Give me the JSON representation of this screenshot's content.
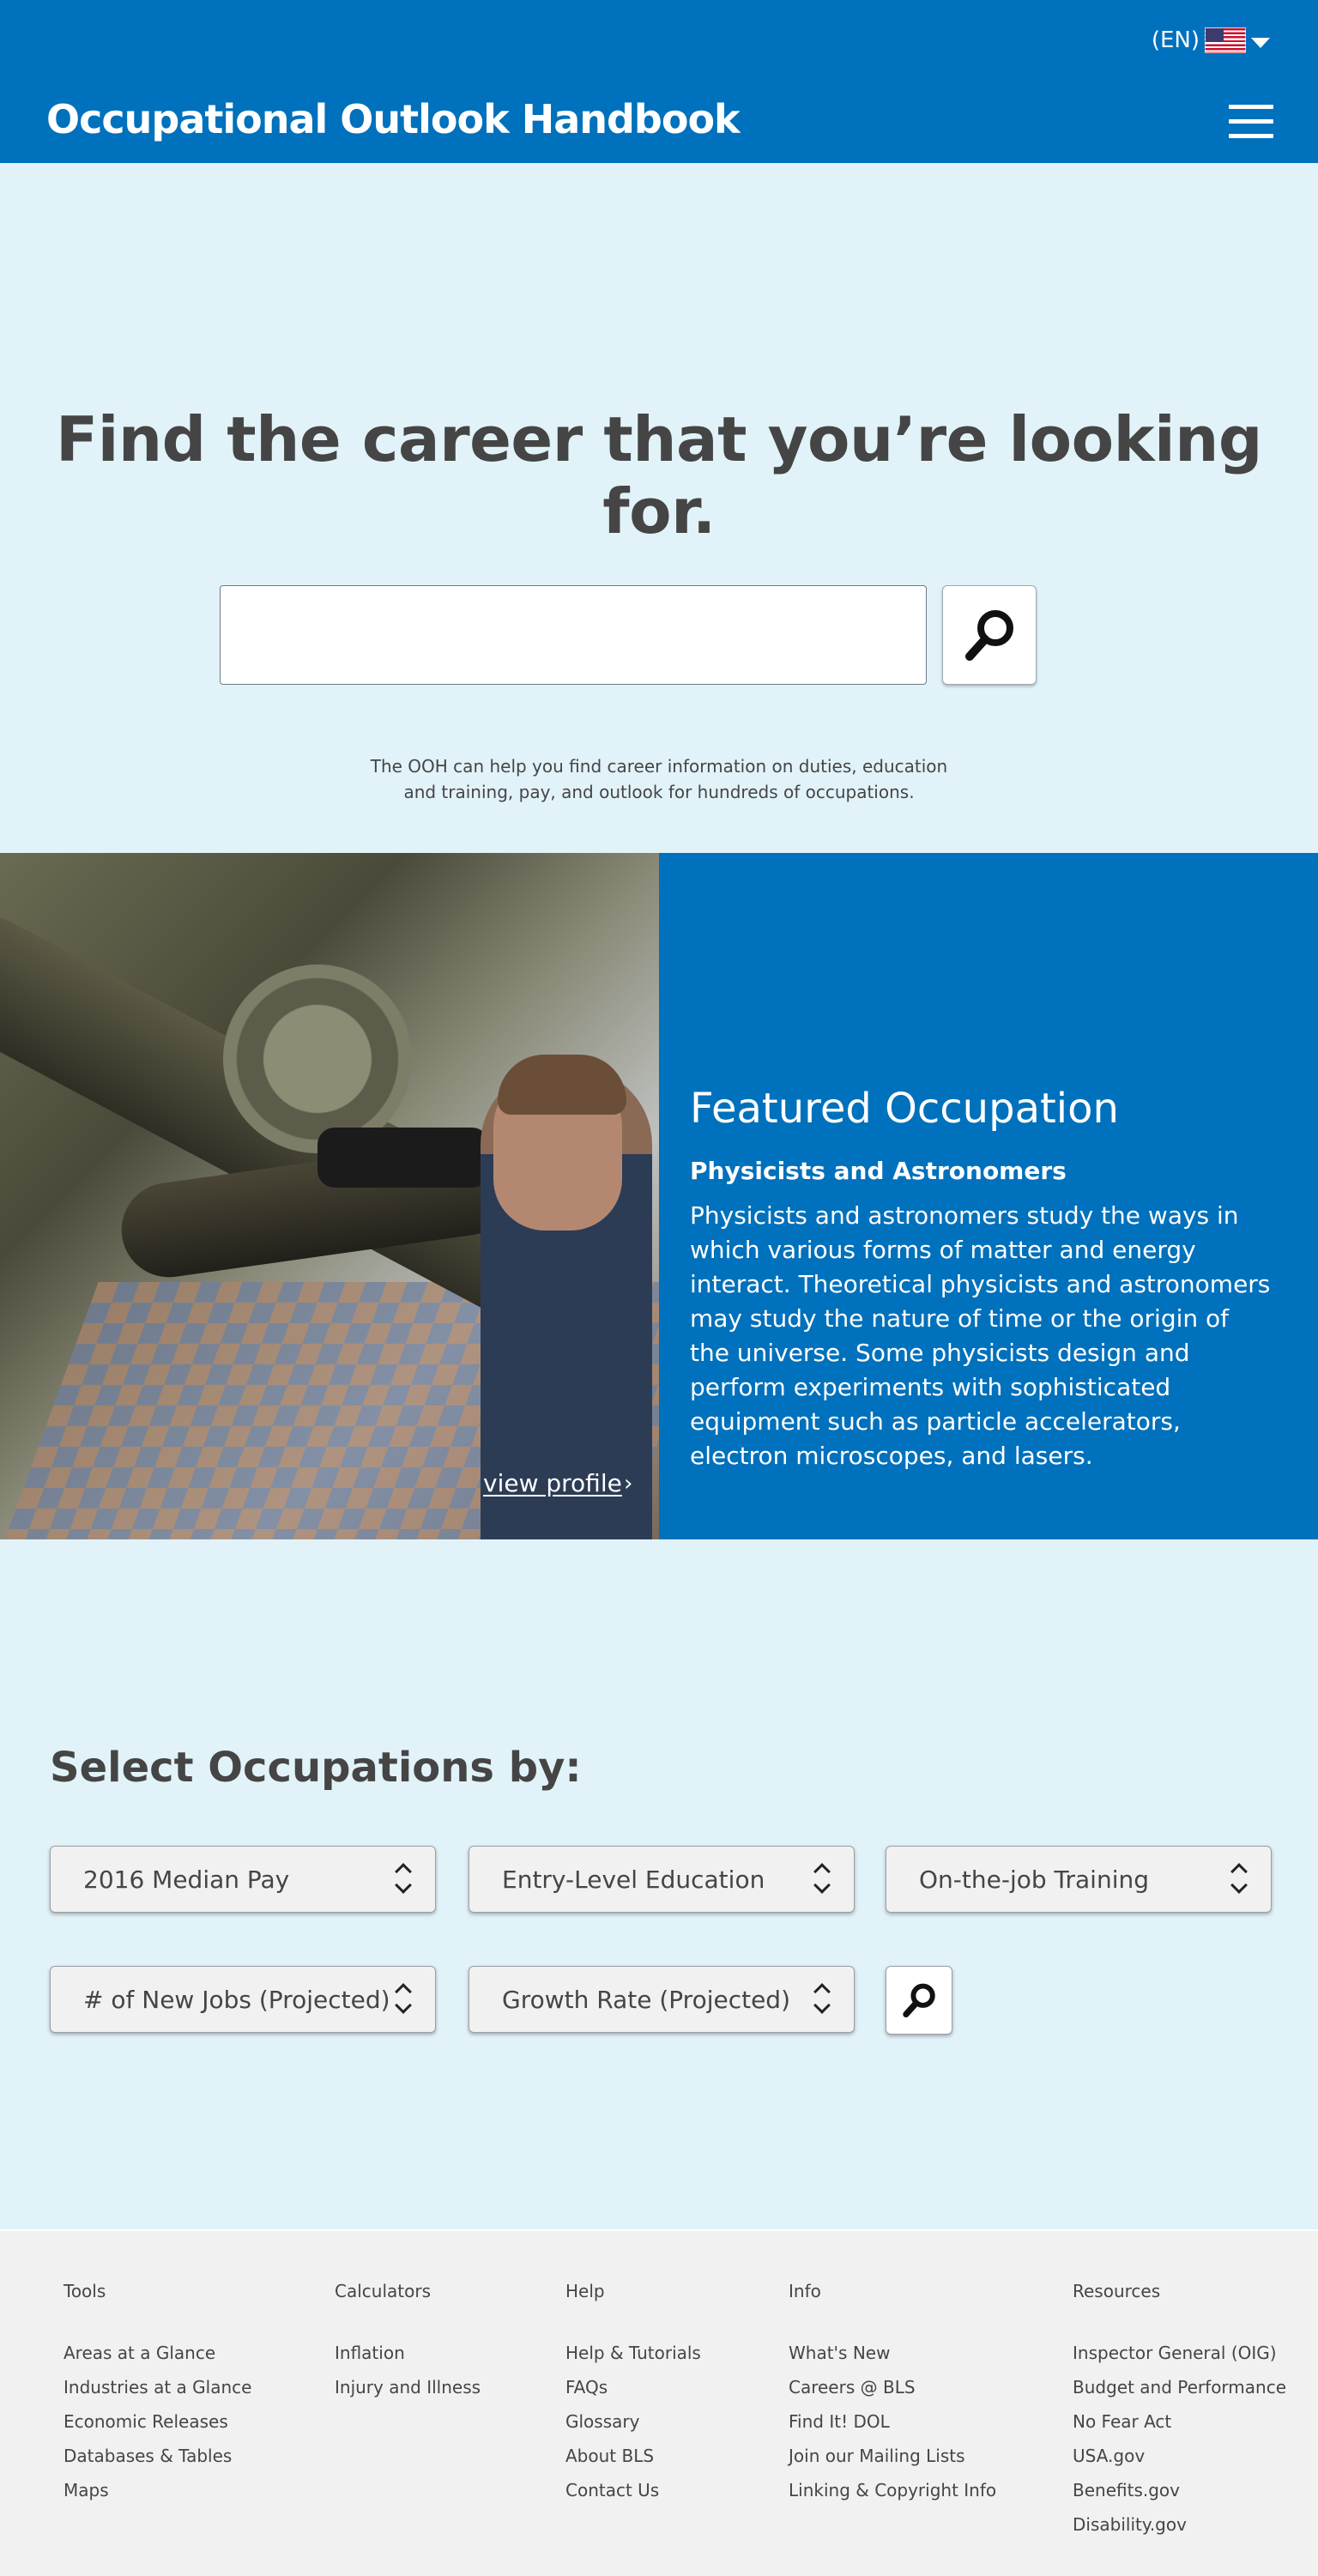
{
  "header": {
    "lang_label": "(EN)",
    "site_title": "Occupational Outlook Handbook"
  },
  "hero": {
    "title": "Find the career that you’re looking for.",
    "search_value": "",
    "description": "The OOH can help you find career information on duties, education and training, pay, and outlook for hundreds of occupations."
  },
  "featured": {
    "heading": "Featured Occupation",
    "occupation": "Physicists and Astronomers",
    "description": "Physicists and astronomers study the ways in which various forms of matter and energy interact. Theoretical physicists and astronomers may study the nature of time or the origin of the universe. Some physicists design and perform experiments with sophisticated equipment such as particle accelerators, electron microscopes, and lasers.",
    "view_profile": "view profile",
    "chevron": "›"
  },
  "select": {
    "title": "Select Occupations by:",
    "dropdowns": [
      {
        "label": "2016 Median Pay"
      },
      {
        "label": "Entry-Level Education"
      },
      {
        "label": "On-the-job Training"
      },
      {
        "label": "# of New Jobs (Projected)"
      },
      {
        "label": "Growth Rate (Projected)"
      }
    ]
  },
  "footer": {
    "columns": [
      {
        "heading": "Tools",
        "links": [
          "Areas at a Glance",
          "Industries at a Glance",
          "Economic Releases",
          "Databases & Tables",
          "Maps"
        ]
      },
      {
        "heading": "Calculators",
        "links": [
          "Inflation",
          "Injury and Illness"
        ]
      },
      {
        "heading": "Help",
        "links": [
          "Help & Tutorials",
          "FAQs",
          "Glossary",
          "About BLS",
          "Contact Us"
        ]
      },
      {
        "heading": "Info",
        "links": [
          "What's New",
          "Careers @ BLS",
          "Find It! DOL",
          "Join our Mailing Lists",
          "Linking & Copyright Info"
        ]
      },
      {
        "heading": "Resources",
        "links": [
          "Inspector General (OIG)",
          "Budget and Performance",
          "No Fear Act",
          "USA.gov",
          "Benefits.gov",
          "Disability.gov"
        ]
      }
    ]
  },
  "colors": {
    "brand_blue": "#0071bc",
    "light_bg": "#e1f3f8",
    "footer_bg": "#f1f1f1",
    "text": "#454545"
  }
}
